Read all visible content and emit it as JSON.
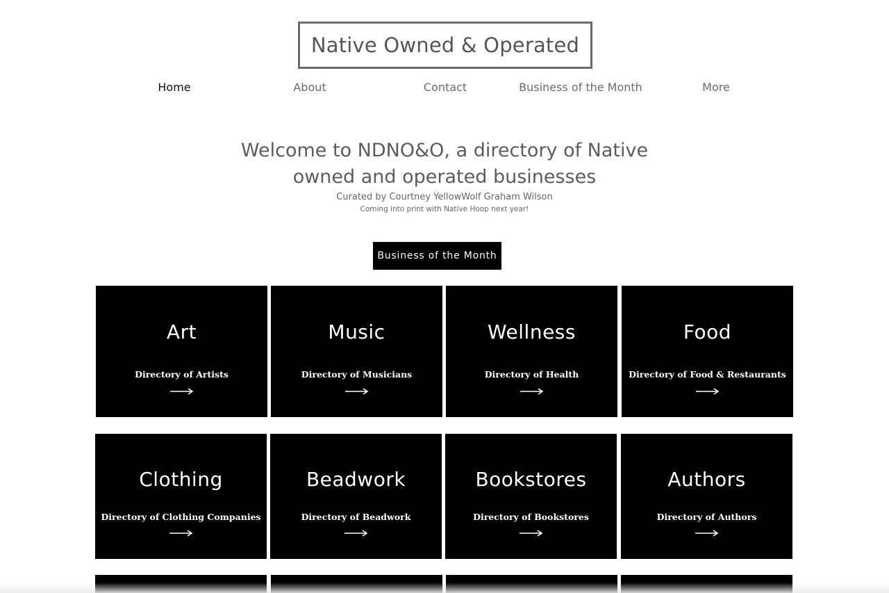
{
  "header": {
    "logo_text": "Native Owned & Operated"
  },
  "nav": {
    "items": [
      {
        "label": "Home",
        "active": true
      },
      {
        "label": "About",
        "active": false
      },
      {
        "label": "Contact",
        "active": false
      },
      {
        "label": "Business of the Month",
        "active": false
      },
      {
        "label": "More",
        "active": false
      }
    ]
  },
  "hero": {
    "welcome_line1": "Welcome to NDNO&O, a directory of Native",
    "welcome_line2": "owned and operated businesses",
    "curated": "Curated by Courtney YellowWolf Graham Wilson",
    "coming": "Coming into print with Native Hoop next year!",
    "button_label": "Business of the Month"
  },
  "tiles": [
    {
      "title": "Art",
      "subtitle": "Directory of Artists",
      "icon": "arrow-right-icon"
    },
    {
      "title": "Music",
      "subtitle": "Directory of Musicians",
      "icon": "arrow-right-icon"
    },
    {
      "title": "Wellness",
      "subtitle": "Directory of Health",
      "icon": "arrow-right-icon"
    },
    {
      "title": "Food",
      "subtitle": "Directory of Food & Restaurants",
      "icon": "arrow-right-icon"
    },
    {
      "title": "Clothing",
      "subtitle": "Directory of Clothing Companies",
      "icon": "arrow-right-icon"
    },
    {
      "title": "Beadwork",
      "subtitle": "Directory of Beadwork",
      "icon": "arrow-right-icon"
    },
    {
      "title": "Bookstores",
      "subtitle": "Directory of Bookstores",
      "icon": "arrow-right-icon"
    },
    {
      "title": "Authors",
      "subtitle": "Directory of Authors",
      "icon": "arrow-right-icon"
    }
  ],
  "colors": {
    "tile_background": "#000000",
    "tile_text": "#ffffff",
    "body_text": "#555555",
    "background": "#ffffff"
  }
}
